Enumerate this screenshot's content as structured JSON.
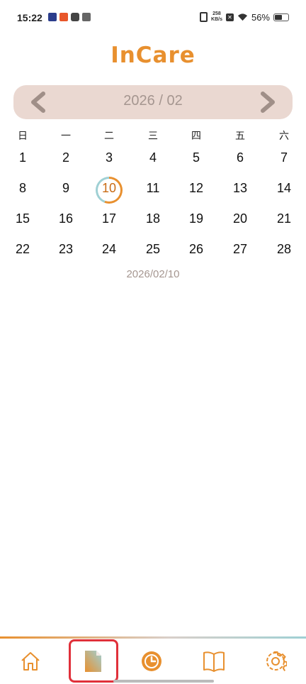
{
  "status_bar": {
    "time": "15:22",
    "netspeed_value": "258",
    "netspeed_unit": "KB/s",
    "battery": "56%",
    "battery_level": 0.56
  },
  "app": {
    "title": "InCare"
  },
  "calendar": {
    "month_label": "2026 / 02",
    "weekdays": [
      "日",
      "一",
      "二",
      "三",
      "四",
      "五",
      "六"
    ],
    "weeks": [
      [
        "1",
        "2",
        "3",
        "4",
        "5",
        "6",
        "7"
      ],
      [
        "8",
        "9",
        "10",
        "11",
        "12",
        "13",
        "14"
      ],
      [
        "15",
        "16",
        "17",
        "18",
        "19",
        "20",
        "21"
      ],
      [
        "22",
        "23",
        "24",
        "25",
        "26",
        "27",
        "28"
      ]
    ],
    "today": "10",
    "selected_date": "2026/02/10"
  },
  "bottom_nav": {
    "items": [
      {
        "icon": "home-icon"
      },
      {
        "icon": "document-icon",
        "active": true
      },
      {
        "icon": "clock-icon"
      },
      {
        "icon": "book-icon"
      },
      {
        "icon": "gear-icon"
      }
    ]
  },
  "colors": {
    "accent": "#e8902f",
    "nav_bg": "#ead8d1",
    "muted_text": "#a59690",
    "teal": "#9fd0d4",
    "highlight": "#e0303a"
  }
}
